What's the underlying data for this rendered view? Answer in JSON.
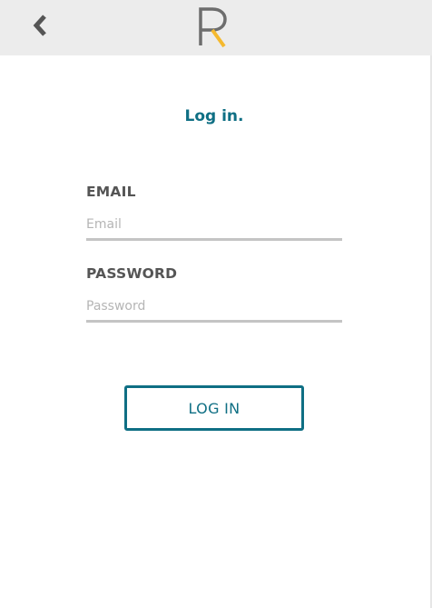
{
  "header": {
    "back_icon": "chevron-left-icon",
    "logo_icon": "r-logo-icon",
    "logo_colors": {
      "stem": "#6d6d6d",
      "leg": "#f5b92e"
    }
  },
  "login": {
    "title": "Log in.",
    "email": {
      "label": "EMAIL",
      "placeholder": "Email",
      "value": ""
    },
    "password": {
      "label": "PASSWORD",
      "placeholder": "Password",
      "value": ""
    },
    "submit_label": "LOG IN"
  },
  "colors": {
    "accent": "#0f6f84",
    "header_bg": "#ececec",
    "label": "#555555",
    "underline": "#c4c4c4"
  }
}
